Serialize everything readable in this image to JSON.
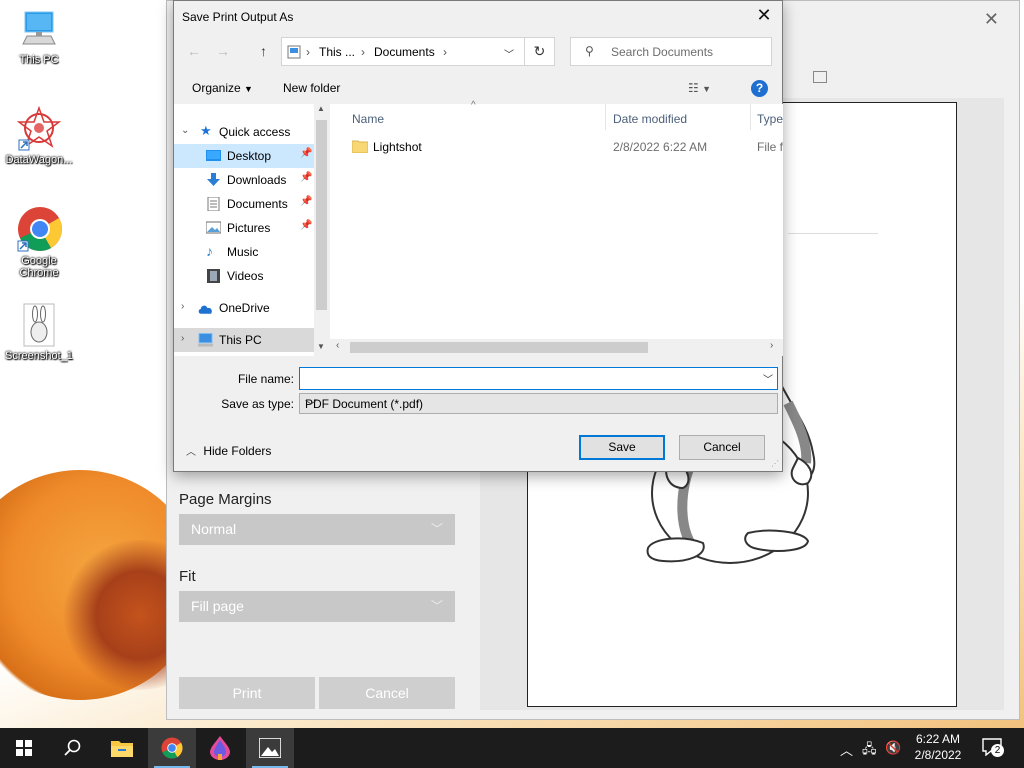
{
  "desktop": {
    "icons": [
      {
        "label": "This PC"
      },
      {
        "label": "DataWagon..."
      },
      {
        "label": "Google Chrome"
      },
      {
        "label": "Screenshot_1"
      }
    ]
  },
  "print_window": {
    "page_margins_label": "Page Margins",
    "page_margins_value": "Normal",
    "fit_label": "Fit",
    "fit_value": "Fill page",
    "print_label": "Print",
    "cancel_label": "Cancel"
  },
  "dialog": {
    "title": "Save Print Output As",
    "address": {
      "segments": [
        "This ...",
        "Documents"
      ]
    },
    "search_placeholder": "Search Documents",
    "toolbar": {
      "organize": "Organize",
      "new_folder": "New folder"
    },
    "nav": {
      "quick_access": "Quick access",
      "items": [
        "Desktop",
        "Downloads",
        "Documents",
        "Pictures",
        "Music",
        "Videos"
      ],
      "onedrive": "OneDrive",
      "this_pc": "This PC"
    },
    "columns": {
      "name": "Name",
      "date_modified": "Date modified",
      "type": "Type"
    },
    "files": [
      {
        "name": "Lightshot",
        "date": "2/8/2022 6:22 AM",
        "type": "File fo"
      }
    ],
    "file_name_label": "File name:",
    "file_name_value": "",
    "save_as_type_label": "Save as type:",
    "save_as_type_value": "PDF Document (*.pdf)",
    "hide_folders": "Hide Folders",
    "save_label": "Save",
    "cancel_label": "Cancel"
  },
  "taskbar": {
    "time": "6:22 AM",
    "date": "2/8/2022",
    "notification_count": "2"
  },
  "colors": {
    "accent": "#0078d7",
    "folder": "#f8d775",
    "taskbar": "#1c1c1c"
  }
}
